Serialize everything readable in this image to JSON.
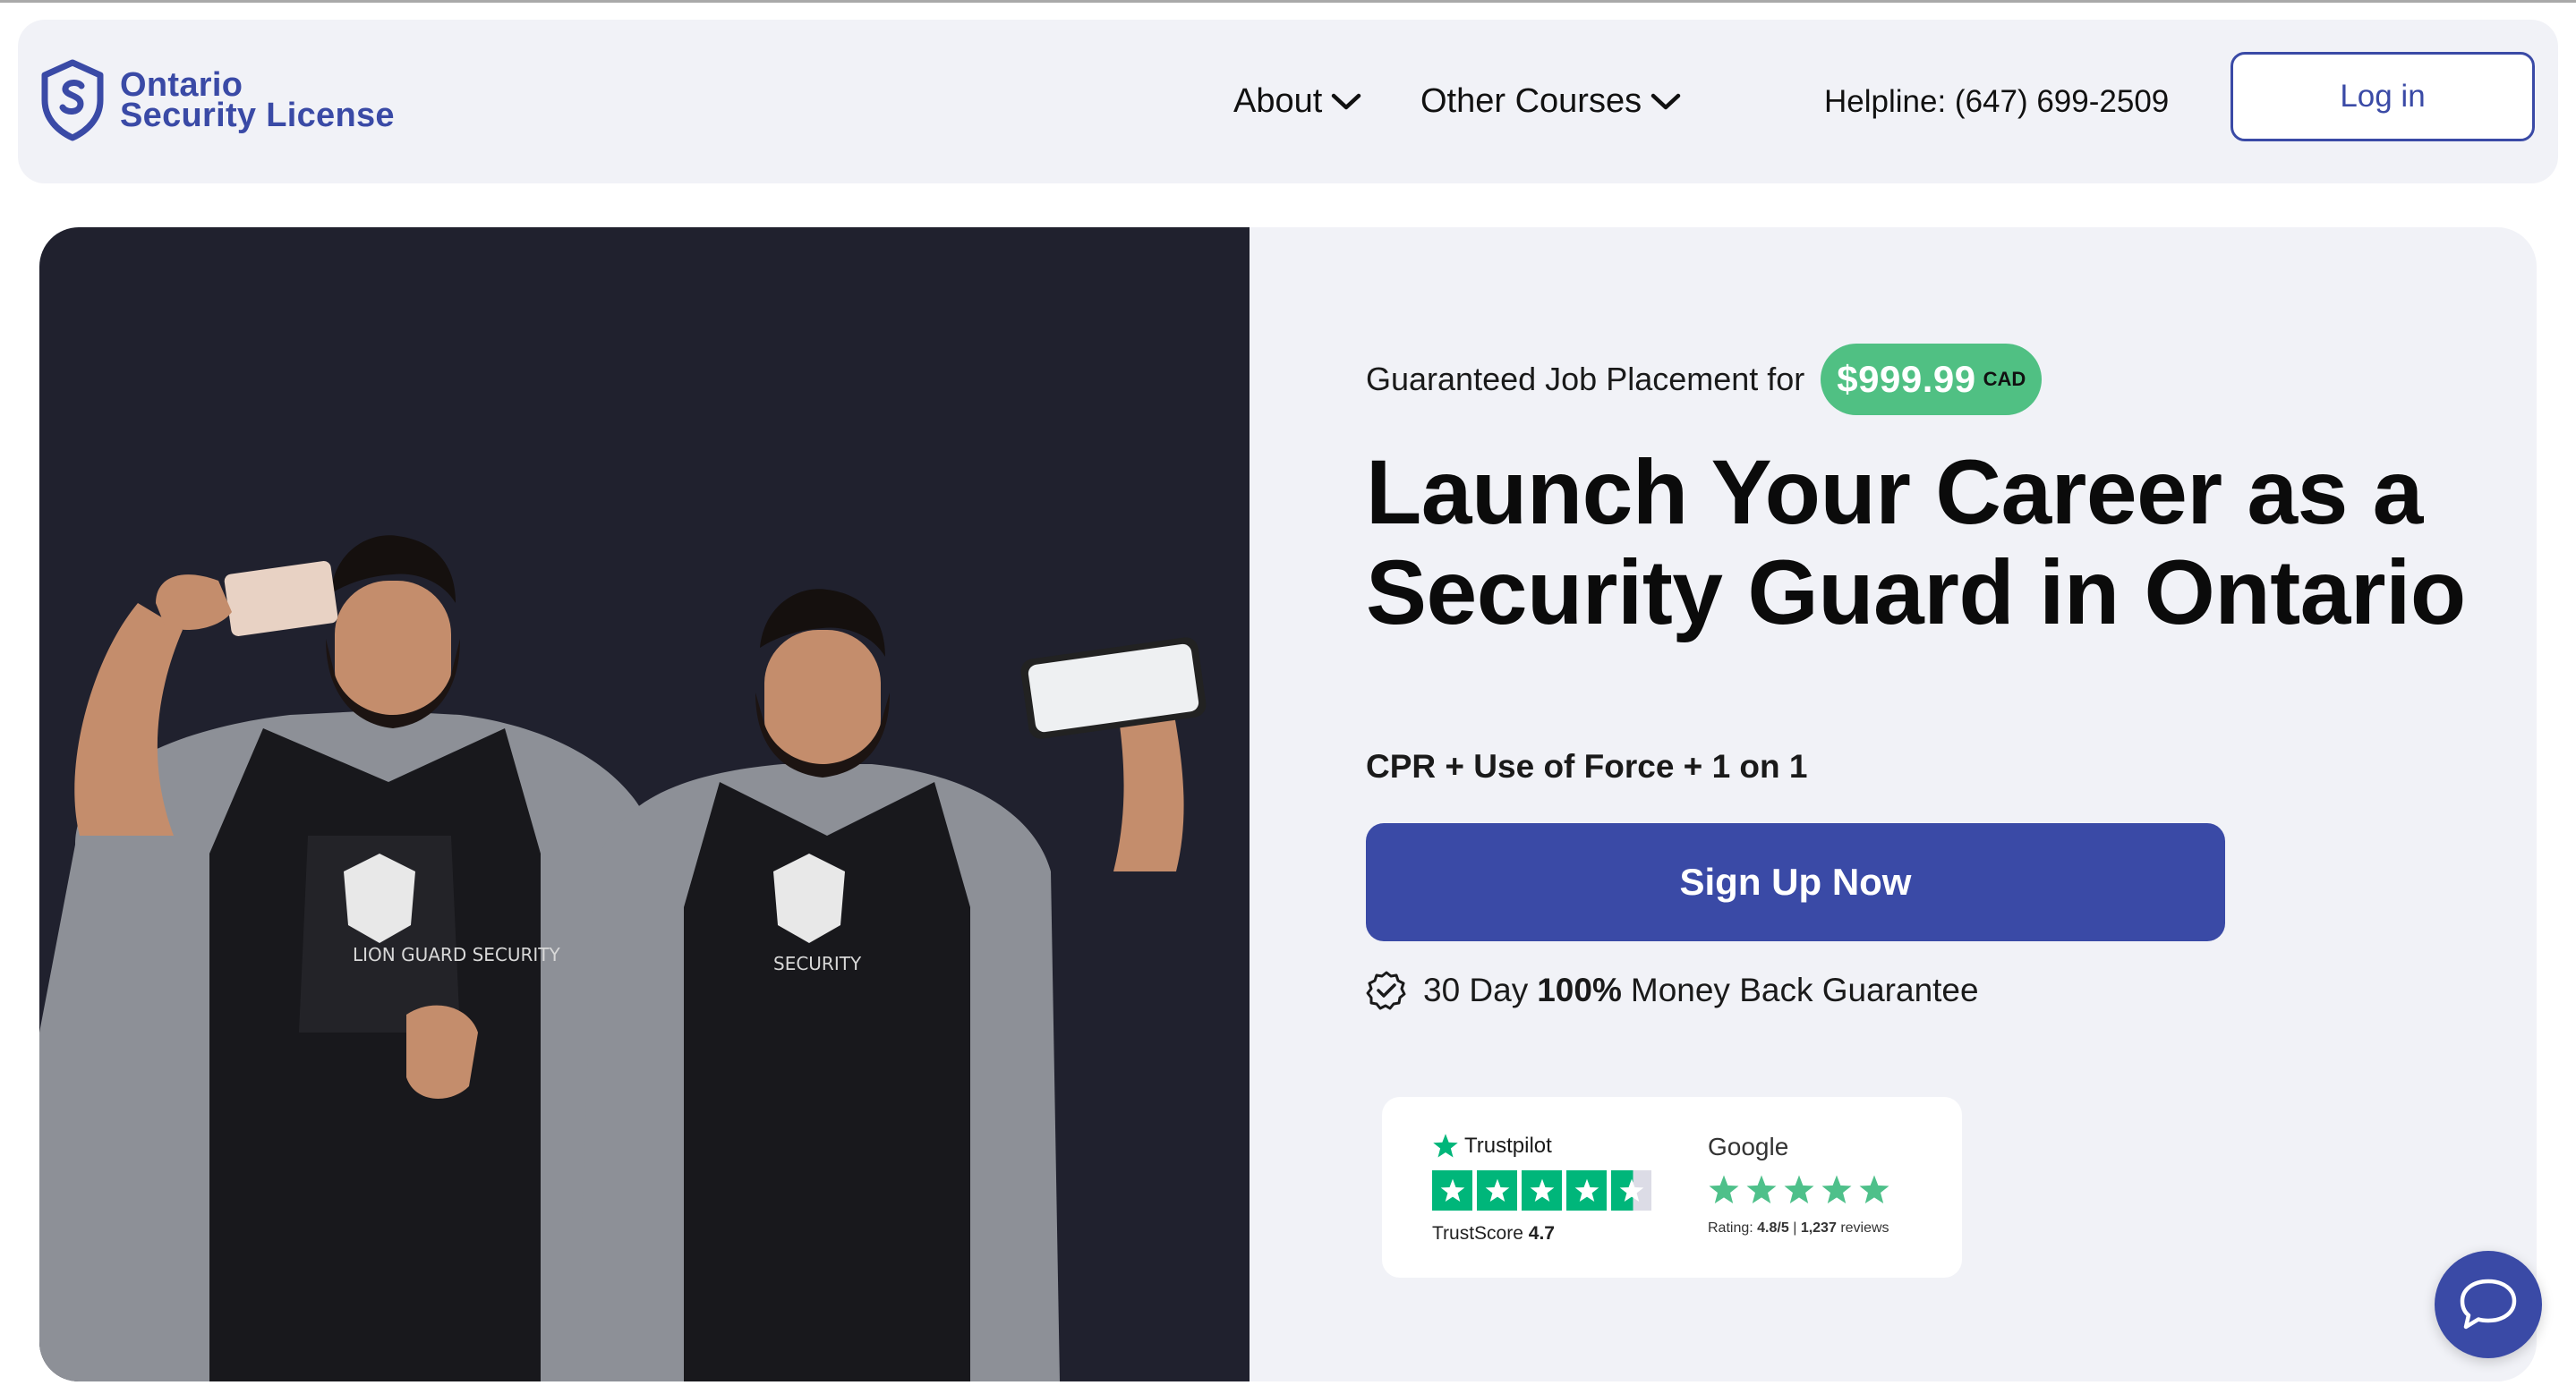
{
  "header": {
    "logo_line1": "Ontario",
    "logo_line2": "Security License",
    "nav": {
      "about": "About",
      "other_courses": "Other Courses"
    },
    "helpline": "Helpline: (647) 699-2509",
    "login_label": "Log in"
  },
  "hero": {
    "placement_prefix": "Guaranteed Job Placement for",
    "price": "$999.99",
    "currency": "CAD",
    "headline_line1": "Launch Your Career as a",
    "headline_line2": "Security Guard in Ontario",
    "features": "CPR + Use of Force + 1 on 1",
    "signup_label": "Sign Up Now",
    "guarantee_prefix": "30 Day",
    "guarantee_bold": "100%",
    "guarantee_suffix": "Money Back Guarantee",
    "photo": {
      "vest_left_text": "LION GUARD SECURITY",
      "vest_right_text": "SECURITY"
    }
  },
  "reviews": {
    "trustpilot_name": "Trustpilot",
    "trustpilot_score_label": "TrustScore",
    "trustpilot_score": "4.7",
    "trustpilot_stars": 4.5,
    "google_name": "Google",
    "google_rating_label": "Rating:",
    "google_rating": "4.8/5",
    "google_reviews": "1,237",
    "google_reviews_suffix": "reviews",
    "google_stars": 5
  },
  "colors": {
    "brand": "#3a4aa6",
    "price_green": "#50c083",
    "trustpilot_green": "#00b67a",
    "hero_bg": "#f1f2f7",
    "photo_bg": "#20212e"
  },
  "icons": [
    "shield-logo-icon",
    "chevron-down-icon",
    "check-badge-icon",
    "trustpilot-star-icon",
    "google-star-icon",
    "chat-bubble-icon"
  ]
}
